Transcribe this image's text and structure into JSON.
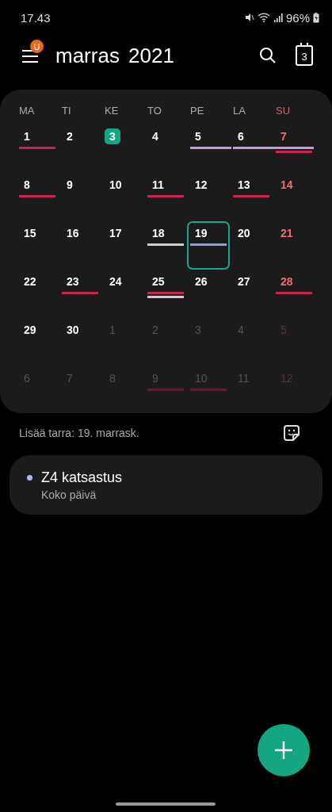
{
  "status_bar": {
    "time": "17.43",
    "battery": "96%"
  },
  "toolbar": {
    "badge": "U",
    "month": "marras",
    "year": "2021",
    "today_icon": "3"
  },
  "calendar": {
    "weekdays": [
      {
        "label": "MA",
        "weekend": false
      },
      {
        "label": "TI",
        "weekend": false
      },
      {
        "label": "KE",
        "weekend": false
      },
      {
        "label": "TO",
        "weekend": false
      },
      {
        "label": "PE",
        "weekend": false
      },
      {
        "label": "LA",
        "weekend": false
      },
      {
        "label": "SU",
        "weekend": true
      }
    ],
    "weeks": [
      [
        {
          "day": "1",
          "kind": "current",
          "weekend": false,
          "today": false,
          "selected": false,
          "events": [
            {
              "kind": "single",
              "color": "#c8264f"
            }
          ]
        },
        {
          "day": "2",
          "kind": "current",
          "weekend": false,
          "today": false,
          "selected": false
        },
        {
          "day": "3",
          "kind": "current",
          "weekend": false,
          "today": true,
          "selected": false
        },
        {
          "day": "4",
          "kind": "current",
          "weekend": false,
          "today": false,
          "selected": false
        },
        {
          "day": "5",
          "kind": "current",
          "weekend": false,
          "today": false,
          "selected": false,
          "events": [
            {
              "kind": "span-start",
              "color": "#c39ad8"
            }
          ]
        },
        {
          "day": "6",
          "kind": "current",
          "weekend": false,
          "today": false,
          "selected": false,
          "events": [
            {
              "kind": "span",
              "color": "#c39ad8"
            }
          ]
        },
        {
          "day": "7",
          "kind": "current",
          "weekend": true,
          "today": false,
          "selected": false,
          "events": [
            {
              "kind": "span-end",
              "color": "#c39ad8"
            },
            {
              "kind": "single",
              "color": "#c8264f"
            }
          ]
        }
      ],
      [
        {
          "day": "8",
          "kind": "current",
          "weekend": false,
          "today": false,
          "selected": false,
          "events": [
            {
              "kind": "single",
              "color": "#c8264f"
            }
          ]
        },
        {
          "day": "9",
          "kind": "current",
          "weekend": false,
          "today": false,
          "selected": false
        },
        {
          "day": "10",
          "kind": "current",
          "weekend": false,
          "today": false,
          "selected": false
        },
        {
          "day": "11",
          "kind": "current",
          "weekend": false,
          "today": false,
          "selected": false,
          "events": [
            {
              "kind": "single",
              "color": "#c8264f"
            }
          ]
        },
        {
          "day": "12",
          "kind": "current",
          "weekend": false,
          "today": false,
          "selected": false
        },
        {
          "day": "13",
          "kind": "current",
          "weekend": false,
          "today": false,
          "selected": false,
          "events": [
            {
              "kind": "single",
              "color": "#c8264f"
            }
          ]
        },
        {
          "day": "14",
          "kind": "current",
          "weekend": true,
          "today": false,
          "selected": false
        }
      ],
      [
        {
          "day": "15",
          "kind": "current",
          "weekend": false,
          "today": false,
          "selected": false
        },
        {
          "day": "16",
          "kind": "current",
          "weekend": false,
          "today": false,
          "selected": false
        },
        {
          "day": "17",
          "kind": "current",
          "weekend": false,
          "today": false,
          "selected": false
        },
        {
          "day": "18",
          "kind": "current",
          "weekend": false,
          "today": false,
          "selected": false,
          "events": [
            {
              "kind": "single",
              "color": "#cccccc"
            }
          ]
        },
        {
          "day": "19",
          "kind": "current",
          "weekend": false,
          "today": false,
          "selected": true,
          "events": [
            {
              "kind": "single",
              "color": "#8a9fe0"
            }
          ]
        },
        {
          "day": "20",
          "kind": "current",
          "weekend": false,
          "today": false,
          "selected": false
        },
        {
          "day": "21",
          "kind": "current",
          "weekend": true,
          "today": false,
          "selected": false
        }
      ],
      [
        {
          "day": "22",
          "kind": "current",
          "weekend": false,
          "today": false,
          "selected": false
        },
        {
          "day": "23",
          "kind": "current",
          "weekend": false,
          "today": false,
          "selected": false,
          "events": [
            {
              "kind": "single",
              "color": "#c8264f"
            }
          ]
        },
        {
          "day": "24",
          "kind": "current",
          "weekend": false,
          "today": false,
          "selected": false
        },
        {
          "day": "25",
          "kind": "current",
          "weekend": false,
          "today": false,
          "selected": false,
          "events": [
            {
              "kind": "single",
              "color": "#c8264f"
            },
            {
              "kind": "single",
              "color": "#cccccc"
            }
          ]
        },
        {
          "day": "26",
          "kind": "current",
          "weekend": false,
          "today": false,
          "selected": false
        },
        {
          "day": "27",
          "kind": "current",
          "weekend": false,
          "today": false,
          "selected": false
        },
        {
          "day": "28",
          "kind": "current",
          "weekend": true,
          "today": false,
          "selected": false,
          "events": [
            {
              "kind": "single",
              "color": "#c8264f"
            }
          ]
        }
      ],
      [
        {
          "day": "29",
          "kind": "current",
          "weekend": false,
          "today": false,
          "selected": false
        },
        {
          "day": "30",
          "kind": "current",
          "weekend": false,
          "today": false,
          "selected": false
        },
        {
          "day": "1",
          "kind": "other",
          "weekend": false,
          "today": false,
          "selected": false
        },
        {
          "day": "2",
          "kind": "other",
          "weekend": false,
          "today": false,
          "selected": false
        },
        {
          "day": "3",
          "kind": "other",
          "weekend": false,
          "today": false,
          "selected": false
        },
        {
          "day": "4",
          "kind": "other",
          "weekend": false,
          "today": false,
          "selected": false
        },
        {
          "day": "5",
          "kind": "other",
          "weekend": true,
          "today": false,
          "selected": false
        }
      ],
      [
        {
          "day": "6",
          "kind": "other",
          "weekend": false,
          "today": false,
          "selected": false
        },
        {
          "day": "7",
          "kind": "other",
          "weekend": false,
          "today": false,
          "selected": false
        },
        {
          "day": "8",
          "kind": "other",
          "weekend": false,
          "today": false,
          "selected": false
        },
        {
          "day": "9",
          "kind": "other",
          "weekend": false,
          "today": false,
          "selected": false,
          "events": [
            {
              "kind": "single",
              "color": "#5a1e2c"
            }
          ]
        },
        {
          "day": "10",
          "kind": "other",
          "weekend": false,
          "today": false,
          "selected": false,
          "events": [
            {
              "kind": "single",
              "color": "#5a1e2c"
            }
          ]
        },
        {
          "day": "11",
          "kind": "other",
          "weekend": false,
          "today": false,
          "selected": false
        },
        {
          "day": "12",
          "kind": "other",
          "weekend": true,
          "today": false,
          "selected": false
        }
      ]
    ]
  },
  "sticker_hint": "Lisää tarra: 19. marrask.",
  "events": [
    {
      "title": "Z4 katsastus",
      "subtitle": "Koko päivä",
      "color": "#a9b8f5"
    }
  ]
}
